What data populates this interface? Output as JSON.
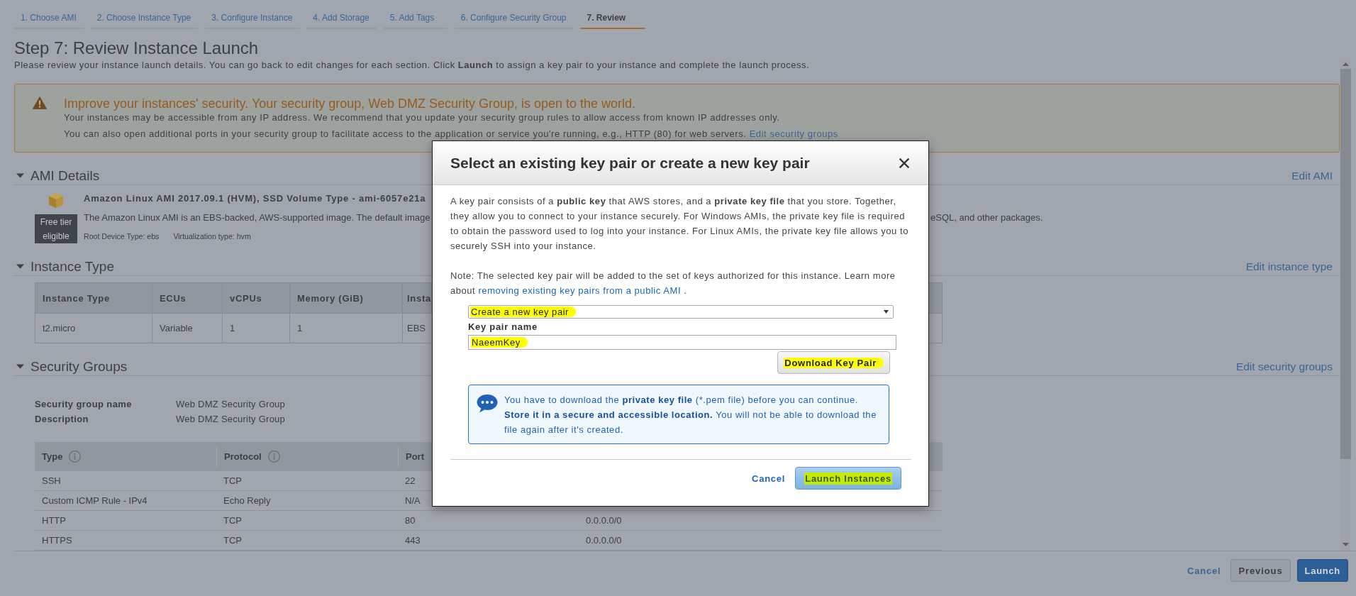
{
  "wizard_tabs": [
    {
      "label": "1. Choose AMI",
      "selected": false
    },
    {
      "label": "2. Choose Instance Type",
      "selected": false
    },
    {
      "label": "3. Configure Instance",
      "selected": false
    },
    {
      "label": "4. Add Storage",
      "selected": false
    },
    {
      "label": "5. Add Tags",
      "selected": false
    },
    {
      "label": "6. Configure Security Group",
      "selected": false
    },
    {
      "label": "7. Review",
      "selected": true
    }
  ],
  "page": {
    "title": "Step 7: Review Instance Launch",
    "intro": "Please review your instance launch details. You can go back to edit changes for each section. Click **Launch** to assign a key pair to your instance and complete the launch process."
  },
  "warning": {
    "title": "Improve your instances' security. Your security group, Web DMZ Security Group, is open to the world.",
    "lines": [
      {
        "text": "Your instances may be accessible from any IP address. We recommend that you update your security group rules to allow access from known IP addresses only."
      },
      {
        "text": "You can also open additional ports in your security group to facilitate access to the application or service you're running, e.g., HTTP (80) for web servers.",
        "link": "Edit security groups"
      }
    ]
  },
  "sections": [
    {
      "kind": "ami",
      "title": "AMI Details",
      "expanded": true,
      "edit_link": "Edit AMI",
      "badge": "Free tier eligible",
      "name": "Amazon Linux AMI 2017.09.1 (HVM), SSD Volume Type - ami-6057e21a",
      "description": "The Amazon Linux AMI is an EBS-backed, AWS-supported image. The default image",
      "description_right": "eSQL, and other packages.",
      "details": [
        "Root Device Type: ebs",
        "Virtualization type: hvm"
      ]
    },
    {
      "kind": "table",
      "title": "Instance Type",
      "expanded": true,
      "edit_link": "Edit instance type",
      "columns": [
        "Instance Type",
        "ECUs",
        "vCPUs",
        "Memory (GiB)",
        "Insta"
      ],
      "rows": [
        [
          "t2.micro",
          "Variable",
          "1",
          "1",
          "EBS"
        ]
      ]
    },
    {
      "kind": "security",
      "title": "Security Groups",
      "expanded": true,
      "edit_link": "Edit security groups",
      "fields": [
        {
          "label": "Security group name",
          "value": "Web DMZ Security Group"
        },
        {
          "label": "Description",
          "value": "Web DMZ Security Group"
        }
      ],
      "columns": [
        {
          "label": "Type",
          "info": true
        },
        {
          "label": "Protocol",
          "info": true
        },
        {
          "label": "Port",
          "info": false
        }
      ],
      "rows": [
        [
          "SSH",
          "TCP",
          "22"
        ],
        [
          "Custom ICMP Rule - IPv4",
          "Echo Reply",
          "N/A"
        ],
        [
          "HTTP",
          "TCP",
          "80",
          "0.0.0.0/0"
        ],
        [
          "HTTPS",
          "TCP",
          "443",
          "0.0.0.0/0"
        ]
      ]
    }
  ],
  "footer": {
    "buttons": [
      {
        "label": "Cancel",
        "kind": "link"
      },
      {
        "label": "Previous",
        "kind": "secondary"
      },
      {
        "label": "Launch",
        "kind": "primary"
      }
    ]
  },
  "modal": {
    "title": "Select an existing key pair or create a new key pair",
    "intro": "A key pair consists of a **public key** that AWS stores, and a **private key file** that you store. Together, they allow you to connect to your instance securely. For Windows AMIs, the private key file is required to obtain the password used to log into your instance. For Linux AMIs, the private key file allows you to securely SSH into your instance.",
    "note": {
      "text": "Note: The selected key pair will be added to the set of keys authorized for this instance. Learn more about",
      "link": "removing existing key pairs from a public AMI",
      "after": " ."
    },
    "key_pair_select": {
      "value": "Create a new key pair",
      "highlighted": true
    },
    "key_pair_name": {
      "label": "Key pair name",
      "value": "NaeemKey",
      "highlighted": true
    },
    "download_button": {
      "label": "Download Key Pair",
      "highlighted": true
    },
    "info": [
      {
        "text": "You have to download the ",
        "bold": false
      },
      {
        "text": "private key file",
        "bold": true
      },
      {
        "text": " (*.pem file) before you can continue. ",
        "bold": false
      },
      {
        "text": "Store it in a secure and accessible location.",
        "bold": true
      },
      {
        "text": " You will not be able to download the file again after it's created.",
        "bold": false
      }
    ],
    "buttons": [
      {
        "label": "Cancel",
        "kind": "link",
        "disabled": false,
        "highlighted": false
      },
      {
        "label": "Launch Instances",
        "kind": "primary",
        "disabled": true,
        "highlighted": true
      }
    ]
  }
}
